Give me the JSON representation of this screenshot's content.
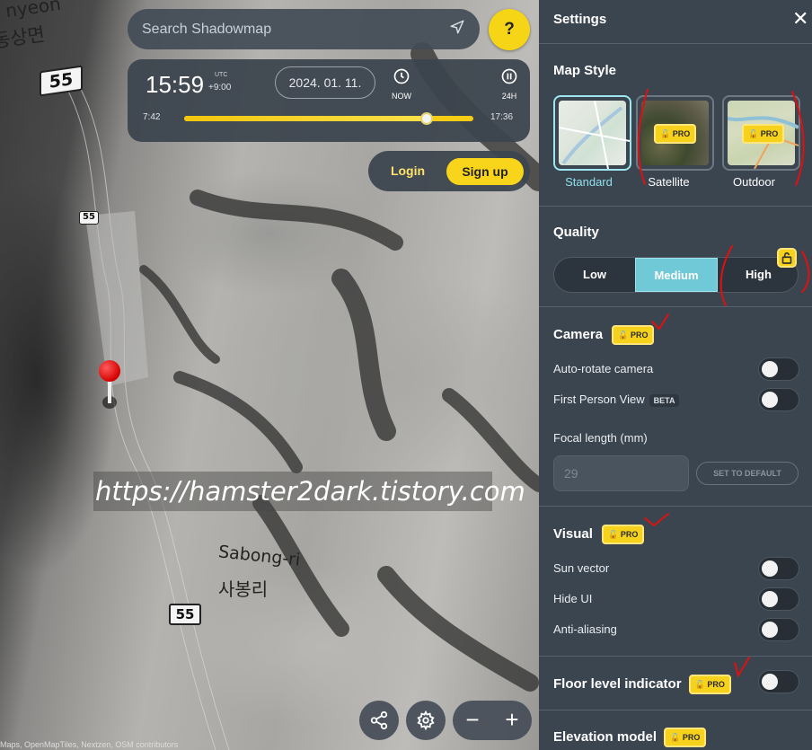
{
  "map": {
    "road_shields": [
      "55",
      "55",
      "55"
    ],
    "place_top_en": "nyeon",
    "place_top_ko": "동상면",
    "place_en": "Sabong-ri",
    "place_ko": "사봉리",
    "watermark": "https://hamster2dark.tistory.com",
    "attribution": "Maps, OpenMapTiles, Nextzen, OSM contributors"
  },
  "search": {
    "placeholder": "Search Shadowmap",
    "icon": "navigation-arrow-icon"
  },
  "help": {
    "label": "?"
  },
  "time": {
    "clock": "15:59",
    "tz_label": "UTC",
    "tz_offset": "+9:00",
    "date": "2024. 01. 11.",
    "now_label": "NOW",
    "h24_label": "24H",
    "sunrise": "7:42",
    "sunset": "17:36",
    "slider_fraction": 0.84
  },
  "auth": {
    "login": "Login",
    "signup": "Sign up"
  },
  "controls": {
    "zoom_out": "−",
    "zoom_in": "+"
  },
  "settings": {
    "title": "Settings",
    "close": "✕",
    "map_style": {
      "title": "Map Style",
      "options": [
        {
          "label": "Standard",
          "selected": true
        },
        {
          "label": "Satellite",
          "pro": "PRO"
        },
        {
          "label": "Outdoor",
          "pro": "PRO"
        }
      ]
    },
    "quality": {
      "title": "Quality",
      "options": [
        "Low",
        "Medium",
        "High"
      ],
      "selected": "Medium"
    },
    "camera": {
      "title": "Camera",
      "pro": "PRO",
      "auto_rotate": "Auto-rotate camera",
      "first_person": "First Person View",
      "beta": "BETA",
      "focal_label": "Focal length (mm)",
      "focal_value": "29",
      "set_default": "SET TO DEFAULT"
    },
    "visual": {
      "title": "Visual",
      "pro": "PRO",
      "sun_vector": "Sun vector",
      "hide_ui": "Hide UI",
      "anti_aliasing": "Anti-aliasing"
    },
    "floor": {
      "title": "Floor level indicator",
      "pro": "PRO"
    },
    "elevation": {
      "title": "Elevation model",
      "pro": "PRO"
    }
  },
  "colors": {
    "accent": "#f7d21c",
    "panel": "#3b4550",
    "selected": "#6fc9d7",
    "annotation": "#e01010"
  }
}
